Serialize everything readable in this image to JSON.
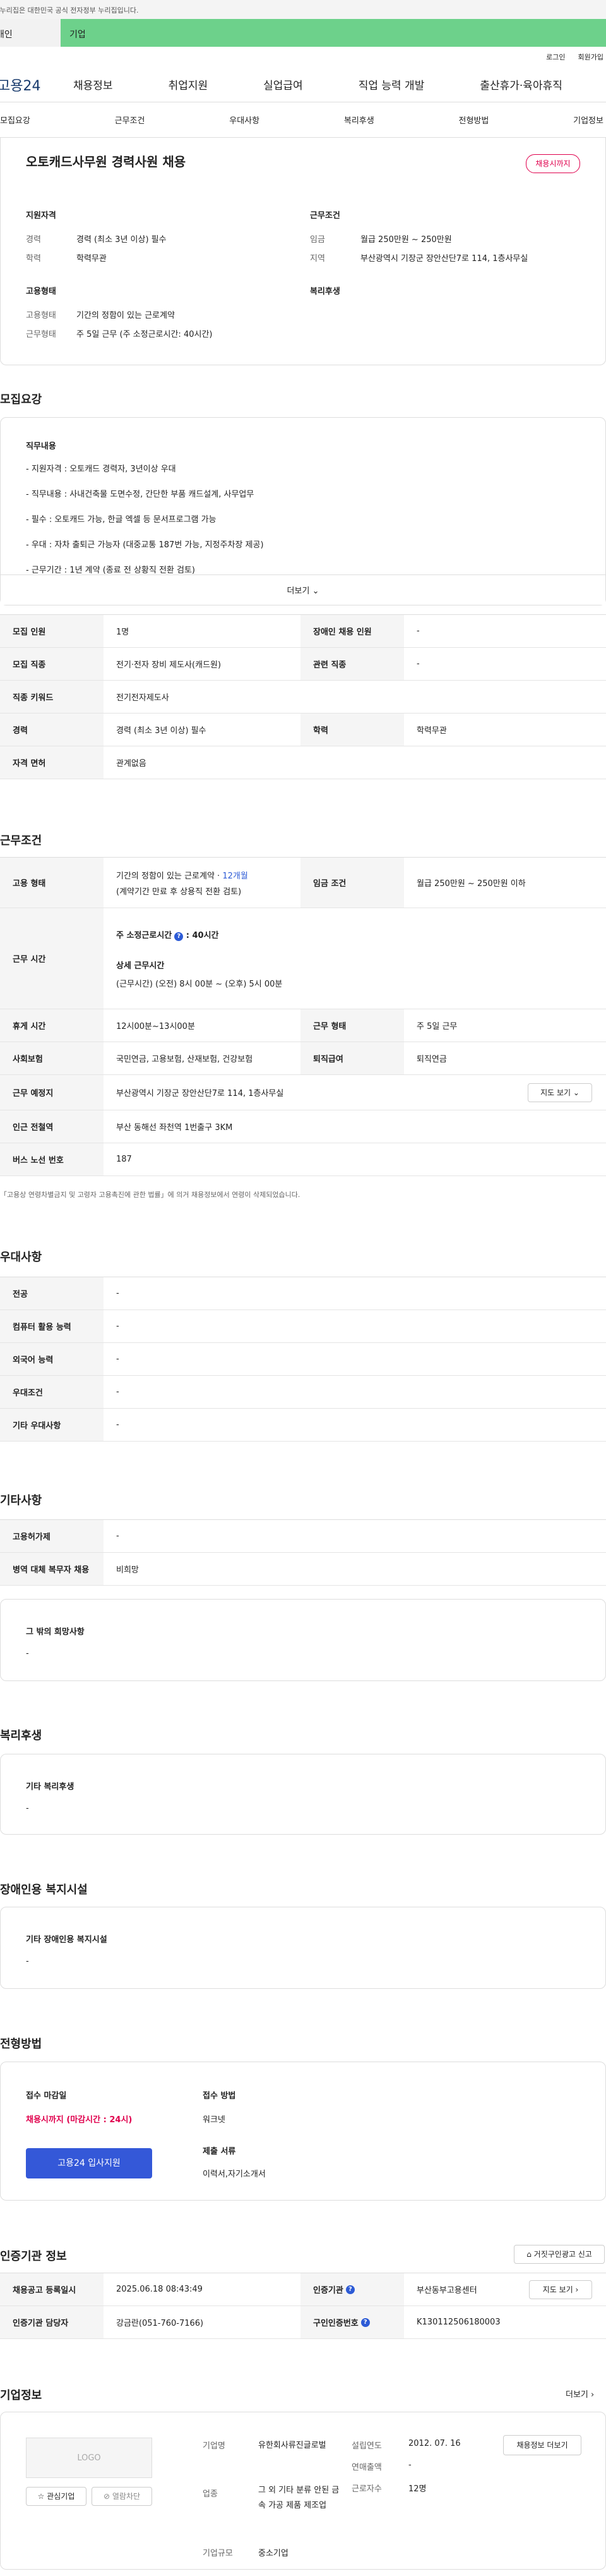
{
  "gov_banner": "이 누리집은 대한민국 공식 전자정부 누리집입니다.",
  "tabs": [
    "개인",
    "기업"
  ],
  "util": [
    "로그인",
    "회원가입"
  ],
  "logo": "고용24",
  "gnb": [
    "채용정보",
    "취업지원",
    "실업급여",
    "직업 능력 개발",
    "출산휴가·육아휴직"
  ],
  "anchors": [
    "모집요강",
    "근무조건",
    "우대사항",
    "복리후생",
    "전형방법",
    "기업정보"
  ],
  "job_title": "오토캐드사무원 경력사원 채용",
  "status_pill": "채용시까지",
  "summary": {
    "qual_title": "지원자격",
    "cond_title": "근무조건",
    "emp_title": "고용형태",
    "welfare_title": "복리후생",
    "career_lbl": "경력",
    "career_val": "경력 (최소 3년 이상) 필수",
    "edu_lbl": "학력",
    "edu_val": "학력무관",
    "wage_lbl": "임금",
    "wage_val": "월급 250만원 ~ 250만원",
    "region_lbl": "지역",
    "region_val": "부산광역시 기장군 장안산단7로 114, 1층사무실",
    "emptype_lbl": "고용형태",
    "emptype_val": "기간의 정함이 있는 근로계약",
    "worktype_lbl": "근무형태",
    "worktype_val": "주 5일 근무 (주 소정근로시간: 40시간)"
  },
  "recruit": {
    "title": "모집요강",
    "duty_title": "직무내용",
    "lines": [
      "- 지원자격 : 오토캐드 경력자, 3년이상 우대",
      "- 직무내용 : 사내건축물 도면수정, 간단한 부품 캐드설계, 사무업무",
      "- 필수 : 오토캐드 가능, 한글 엑셀 등 문서프로그램 가능",
      "- 우대 : 자차 출퇴근 가능자 (대중교통 187번 가능, 지정주차장 제공)",
      "- 근무기간 : 1년 계약 (종료 전 상황직 전환 검토)"
    ],
    "more": "더보기",
    "rows": [
      [
        "모집 인원",
        "1명",
        "장애인 채용 인원",
        "-"
      ],
      [
        "모집 직종",
        "전기·전자 장비 제도사(캐드원)",
        "관련 직종",
        "-"
      ],
      [
        "직종 키워드",
        "전기전자제도사"
      ],
      [
        "경력",
        "경력 (최소 3년 이상) 필수",
        "학력",
        "학력무관"
      ],
      [
        "자격 면허",
        "관계없음"
      ]
    ]
  },
  "conditions": {
    "title": "근무조건",
    "emp_lbl": "고용 형태",
    "emp_val1": "기간의 정함이 있는 근로계약 · ",
    "emp_val_hl": "12개월",
    "emp_val2": "(계약기간 만료 후 상용직 전환 검토)",
    "wage_lbl": "임금 조건",
    "wage_val": "월급 250만원 ~ 250만원 이하",
    "hours_lbl": "근무 시간",
    "hours_week": "주 소정근로시간",
    "hours_week_val": ": 40시간",
    "hours_detail_title": "상세 근무시간",
    "hours_detail": "(근무시간) (오전) 8시 00분 ~ (오후) 5시 00분",
    "break_lbl": "휴게 시간",
    "break_val": "12시00분~13시00분",
    "shift_lbl": "근무 형태",
    "shift_val": "주 5일 근무",
    "ins_lbl": "사회보험",
    "ins_val": "국민연금, 고용보험, 산재보험, 건강보험",
    "sev_lbl": "퇴직급여",
    "sev_val": "퇴직연금",
    "addr_lbl": "근무 예정지",
    "addr_val": "부산광역시 기장군 장안산단7로 114, 1층사무실",
    "map_btn": "지도 보기",
    "station_lbl": "인근 전철역",
    "station_val": "부산 동해선 좌천역 1번출구 3KM",
    "bus_lbl": "버스 노선 번호",
    "bus_val": "187",
    "note": "「고용상 연령차별금지 및 고령자 고용촉진에 관한 법률」에 의거 채용정보에서 연령이 삭제되었습니다."
  },
  "preference": {
    "title": "우대사항",
    "rows": [
      [
        "전공",
        "-"
      ],
      [
        "컴퓨터 활용 능력",
        "-"
      ],
      [
        "외국어 능력",
        "-"
      ],
      [
        "우대조건",
        "-"
      ],
      [
        "기타 우대사항",
        "-"
      ]
    ]
  },
  "etc": {
    "title": "기타사항",
    "rows": [
      [
        "고용허가제",
        "-"
      ],
      [
        "병역 대체 복무자 채용",
        "비희망"
      ]
    ],
    "other_title": "그 밖의 희망사항",
    "other_val": "-"
  },
  "welfare": {
    "title": "복리후생",
    "sub": "기타 복리후생",
    "val": "-"
  },
  "disability": {
    "title": "장애인용 복지시설",
    "sub": "기타 장애인용 복지시설",
    "val": "-"
  },
  "selection": {
    "title": "전형방법",
    "deadline_lbl": "접수 마감일",
    "deadline_val": "채용시까지 (마감시간 : 24시)",
    "apply_btn": "고용24 입사지원",
    "method_lbl": "접수 방법",
    "method_val": "워크넷",
    "docs_lbl": "제출 서류",
    "docs_val": "이력서,자기소개서"
  },
  "certify": {
    "title": "인증기관 정보",
    "report_btn": "거짓구인광고 신고",
    "rows": [
      [
        "채용공고 등록일시",
        "2025.06.18 08:43:49",
        "인증기관",
        "부산동부고용센터"
      ],
      [
        "인증기관 담당자",
        "강금란(051-760-7166)",
        "구인인증번호",
        "K130112506180003"
      ]
    ],
    "map_btn": "지도 보기"
  },
  "company": {
    "title": "기업정보",
    "more": "더보기",
    "logo": "LOGO",
    "fav_btn": "관심기업",
    "view_btn": "열람차단",
    "name_lbl": "기업명",
    "name_val": "유한회사류진글로벌",
    "ind_lbl": "업종",
    "ind_val": "그 외 기타 분류 안된 금속 가공 제품 제조업",
    "size_lbl": "기업규모",
    "size_val": "중소기업",
    "year_lbl": "설립연도",
    "year_val": "2012. 07. 16",
    "sales_lbl": "연매출액",
    "sales_val": "-",
    "emp_lbl": "근로자수",
    "emp_val": "12명",
    "jobs_btn": "채용정보 더보기"
  }
}
